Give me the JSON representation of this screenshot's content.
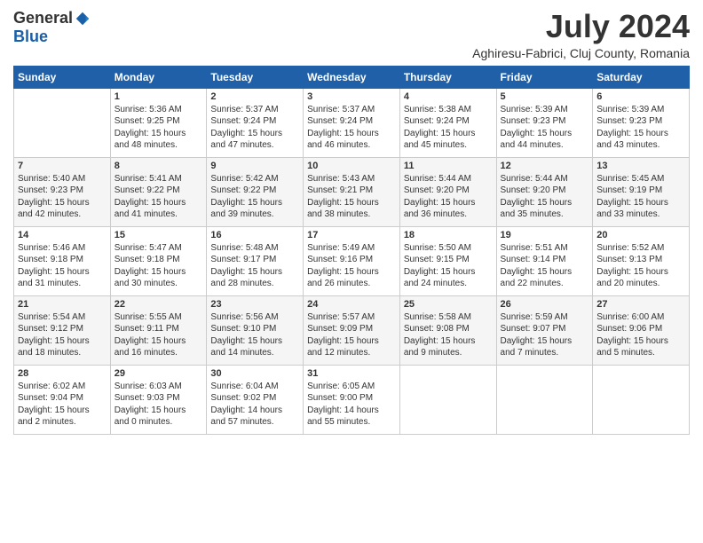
{
  "header": {
    "logo_general": "General",
    "logo_blue": "Blue",
    "month_title": "July 2024",
    "location": "Aghiresu-Fabrici, Cluj County, Romania"
  },
  "columns": [
    "Sunday",
    "Monday",
    "Tuesday",
    "Wednesday",
    "Thursday",
    "Friday",
    "Saturday"
  ],
  "weeks": [
    [
      {
        "day": "",
        "sunrise": "",
        "sunset": "",
        "daylight": ""
      },
      {
        "day": "1",
        "sunrise": "Sunrise: 5:36 AM",
        "sunset": "Sunset: 9:25 PM",
        "daylight": "Daylight: 15 hours and 48 minutes."
      },
      {
        "day": "2",
        "sunrise": "Sunrise: 5:37 AM",
        "sunset": "Sunset: 9:24 PM",
        "daylight": "Daylight: 15 hours and 47 minutes."
      },
      {
        "day": "3",
        "sunrise": "Sunrise: 5:37 AM",
        "sunset": "Sunset: 9:24 PM",
        "daylight": "Daylight: 15 hours and 46 minutes."
      },
      {
        "day": "4",
        "sunrise": "Sunrise: 5:38 AM",
        "sunset": "Sunset: 9:24 PM",
        "daylight": "Daylight: 15 hours and 45 minutes."
      },
      {
        "day": "5",
        "sunrise": "Sunrise: 5:39 AM",
        "sunset": "Sunset: 9:23 PM",
        "daylight": "Daylight: 15 hours and 44 minutes."
      },
      {
        "day": "6",
        "sunrise": "Sunrise: 5:39 AM",
        "sunset": "Sunset: 9:23 PM",
        "daylight": "Daylight: 15 hours and 43 minutes."
      }
    ],
    [
      {
        "day": "7",
        "sunrise": "Sunrise: 5:40 AM",
        "sunset": "Sunset: 9:23 PM",
        "daylight": "Daylight: 15 hours and 42 minutes."
      },
      {
        "day": "8",
        "sunrise": "Sunrise: 5:41 AM",
        "sunset": "Sunset: 9:22 PM",
        "daylight": "Daylight: 15 hours and 41 minutes."
      },
      {
        "day": "9",
        "sunrise": "Sunrise: 5:42 AM",
        "sunset": "Sunset: 9:22 PM",
        "daylight": "Daylight: 15 hours and 39 minutes."
      },
      {
        "day": "10",
        "sunrise": "Sunrise: 5:43 AM",
        "sunset": "Sunset: 9:21 PM",
        "daylight": "Daylight: 15 hours and 38 minutes."
      },
      {
        "day": "11",
        "sunrise": "Sunrise: 5:44 AM",
        "sunset": "Sunset: 9:20 PM",
        "daylight": "Daylight: 15 hours and 36 minutes."
      },
      {
        "day": "12",
        "sunrise": "Sunrise: 5:44 AM",
        "sunset": "Sunset: 9:20 PM",
        "daylight": "Daylight: 15 hours and 35 minutes."
      },
      {
        "day": "13",
        "sunrise": "Sunrise: 5:45 AM",
        "sunset": "Sunset: 9:19 PM",
        "daylight": "Daylight: 15 hours and 33 minutes."
      }
    ],
    [
      {
        "day": "14",
        "sunrise": "Sunrise: 5:46 AM",
        "sunset": "Sunset: 9:18 PM",
        "daylight": "Daylight: 15 hours and 31 minutes."
      },
      {
        "day": "15",
        "sunrise": "Sunrise: 5:47 AM",
        "sunset": "Sunset: 9:18 PM",
        "daylight": "Daylight: 15 hours and 30 minutes."
      },
      {
        "day": "16",
        "sunrise": "Sunrise: 5:48 AM",
        "sunset": "Sunset: 9:17 PM",
        "daylight": "Daylight: 15 hours and 28 minutes."
      },
      {
        "day": "17",
        "sunrise": "Sunrise: 5:49 AM",
        "sunset": "Sunset: 9:16 PM",
        "daylight": "Daylight: 15 hours and 26 minutes."
      },
      {
        "day": "18",
        "sunrise": "Sunrise: 5:50 AM",
        "sunset": "Sunset: 9:15 PM",
        "daylight": "Daylight: 15 hours and 24 minutes."
      },
      {
        "day": "19",
        "sunrise": "Sunrise: 5:51 AM",
        "sunset": "Sunset: 9:14 PM",
        "daylight": "Daylight: 15 hours and 22 minutes."
      },
      {
        "day": "20",
        "sunrise": "Sunrise: 5:52 AM",
        "sunset": "Sunset: 9:13 PM",
        "daylight": "Daylight: 15 hours and 20 minutes."
      }
    ],
    [
      {
        "day": "21",
        "sunrise": "Sunrise: 5:54 AM",
        "sunset": "Sunset: 9:12 PM",
        "daylight": "Daylight: 15 hours and 18 minutes."
      },
      {
        "day": "22",
        "sunrise": "Sunrise: 5:55 AM",
        "sunset": "Sunset: 9:11 PM",
        "daylight": "Daylight: 15 hours and 16 minutes."
      },
      {
        "day": "23",
        "sunrise": "Sunrise: 5:56 AM",
        "sunset": "Sunset: 9:10 PM",
        "daylight": "Daylight: 15 hours and 14 minutes."
      },
      {
        "day": "24",
        "sunrise": "Sunrise: 5:57 AM",
        "sunset": "Sunset: 9:09 PM",
        "daylight": "Daylight: 15 hours and 12 minutes."
      },
      {
        "day": "25",
        "sunrise": "Sunrise: 5:58 AM",
        "sunset": "Sunset: 9:08 PM",
        "daylight": "Daylight: 15 hours and 9 minutes."
      },
      {
        "day": "26",
        "sunrise": "Sunrise: 5:59 AM",
        "sunset": "Sunset: 9:07 PM",
        "daylight": "Daylight: 15 hours and 7 minutes."
      },
      {
        "day": "27",
        "sunrise": "Sunrise: 6:00 AM",
        "sunset": "Sunset: 9:06 PM",
        "daylight": "Daylight: 15 hours and 5 minutes."
      }
    ],
    [
      {
        "day": "28",
        "sunrise": "Sunrise: 6:02 AM",
        "sunset": "Sunset: 9:04 PM",
        "daylight": "Daylight: 15 hours and 2 minutes."
      },
      {
        "day": "29",
        "sunrise": "Sunrise: 6:03 AM",
        "sunset": "Sunset: 9:03 PM",
        "daylight": "Daylight: 15 hours and 0 minutes."
      },
      {
        "day": "30",
        "sunrise": "Sunrise: 6:04 AM",
        "sunset": "Sunset: 9:02 PM",
        "daylight": "Daylight: 14 hours and 57 minutes."
      },
      {
        "day": "31",
        "sunrise": "Sunrise: 6:05 AM",
        "sunset": "Sunset: 9:00 PM",
        "daylight": "Daylight: 14 hours and 55 minutes."
      },
      {
        "day": "",
        "sunrise": "",
        "sunset": "",
        "daylight": ""
      },
      {
        "day": "",
        "sunrise": "",
        "sunset": "",
        "daylight": ""
      },
      {
        "day": "",
        "sunrise": "",
        "sunset": "",
        "daylight": ""
      }
    ]
  ]
}
